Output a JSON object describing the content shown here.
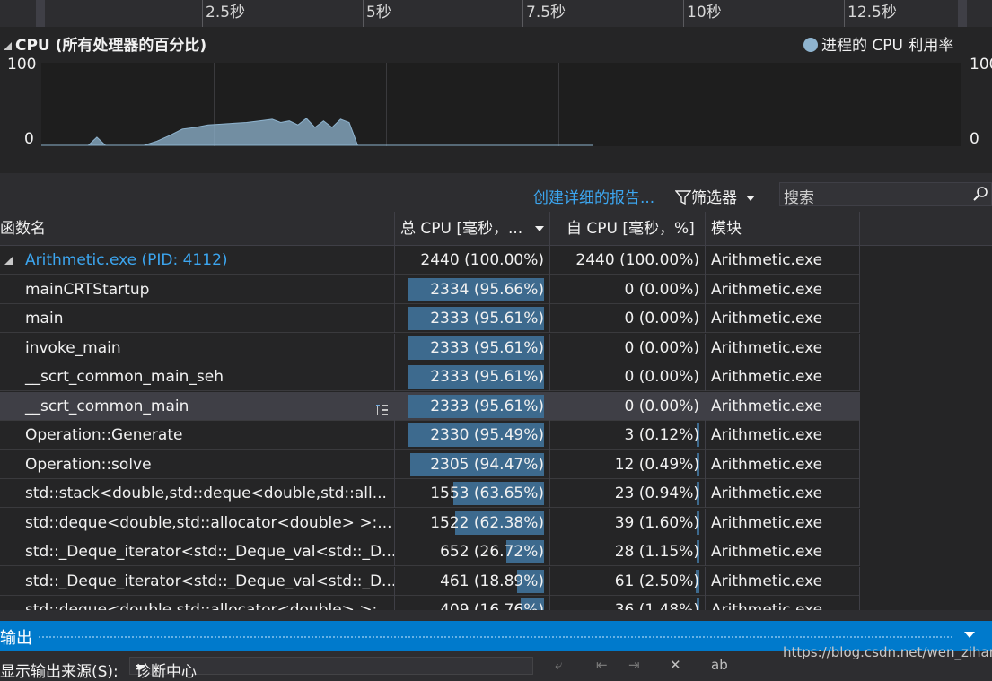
{
  "timeline": {
    "ticks": [
      "2.5秒",
      "5秒",
      "7.5秒",
      "10秒",
      "12.5秒"
    ]
  },
  "cpu_panel": {
    "title": "CPU (所有处理器的百分比)",
    "legend": "进程的 CPU 利用率",
    "y_max_left": "100",
    "y_min_left": "0",
    "y_max_right": "100",
    "y_min_right": "0",
    "series_color": "#8fb4cf"
  },
  "chart_data": {
    "type": "area",
    "title": "CPU (所有处理器的百分比)",
    "ylim": [
      0,
      100
    ],
    "series": [
      {
        "name": "进程的 CPU 利用率",
        "x": [
          0.0,
          1.1,
          1.3,
          1.5,
          2.4,
          2.7,
          3.0,
          3.3,
          3.6,
          3.9,
          4.2,
          4.5,
          4.8,
          5.1,
          5.4,
          5.6,
          5.8,
          6.0,
          6.2,
          6.4,
          6.6,
          6.8,
          7.0,
          7.2,
          7.4,
          7.6,
          12.9
        ],
        "values": [
          0,
          0,
          10,
          0,
          0,
          5,
          12,
          20,
          22,
          25,
          26,
          27,
          28,
          30,
          32,
          28,
          30,
          25,
          33,
          22,
          30,
          22,
          32,
          28,
          0,
          0,
          0
        ]
      }
    ]
  },
  "toolbar": {
    "report_link": "创建详细的报告...",
    "filter_label": "筛选器",
    "search_placeholder": "搜索"
  },
  "table": {
    "columns": [
      "函数名",
      "总 CPU [毫秒，...",
      "自 CPU [毫秒，%]",
      "模块"
    ],
    "rows": [
      {
        "name": "Arithmetic.exe (PID: 4112)",
        "total": "2440 (100.00%)",
        "total_pct": 100.0,
        "self": "2440 (100.00%)",
        "self_pct": 100.0,
        "module": "Arithmetic.exe"
      },
      {
        "name": "mainCRTStartup",
        "total": "2334 (95.66%)",
        "total_pct": 95.66,
        "self": "0 (0.00%)",
        "self_pct": 0.0,
        "module": "Arithmetic.exe"
      },
      {
        "name": "main",
        "total": "2333 (95.61%)",
        "total_pct": 95.61,
        "self": "0 (0.00%)",
        "self_pct": 0.0,
        "module": "Arithmetic.exe"
      },
      {
        "name": "invoke_main",
        "total": "2333 (95.61%)",
        "total_pct": 95.61,
        "self": "0 (0.00%)",
        "self_pct": 0.0,
        "module": "Arithmetic.exe"
      },
      {
        "name": "__scrt_common_main_seh",
        "total": "2333 (95.61%)",
        "total_pct": 95.61,
        "self": "0 (0.00%)",
        "self_pct": 0.0,
        "module": "Arithmetic.exe"
      },
      {
        "name": "__scrt_common_main",
        "total": "2333 (95.61%)",
        "total_pct": 95.61,
        "self": "0 (0.00%)",
        "self_pct": 0.0,
        "module": "Arithmetic.exe"
      },
      {
        "name": "Operation::Generate",
        "total": "2330 (95.49%)",
        "total_pct": 95.49,
        "self": "3 (0.12%)",
        "self_pct": 0.12,
        "module": "Arithmetic.exe"
      },
      {
        "name": "Operation::solve",
        "total": "2305 (94.47%)",
        "total_pct": 94.47,
        "self": "12 (0.49%)",
        "self_pct": 0.49,
        "module": "Arithmetic.exe"
      },
      {
        "name": "std::stack<double,std::deque<double,std::all...",
        "total": "1553 (63.65%)",
        "total_pct": 63.65,
        "self": "23 (0.94%)",
        "self_pct": 0.94,
        "module": "Arithmetic.exe"
      },
      {
        "name": "std::deque<double,std::allocator<double> >:...",
        "total": "1522 (62.38%)",
        "total_pct": 62.38,
        "self": "39 (1.60%)",
        "self_pct": 1.6,
        "module": "Arithmetic.exe"
      },
      {
        "name": "std::_Deque_iterator<std::_Deque_val<std::_D...",
        "total": "652 (26.72%)",
        "total_pct": 26.72,
        "self": "28 (1.15%)",
        "self_pct": 1.15,
        "module": "Arithmetic.exe"
      },
      {
        "name": "std::_Deque_iterator<std::_Deque_val<std::_D...",
        "total": "461 (18.89%)",
        "total_pct": 18.89,
        "self": "61 (2.50%)",
        "self_pct": 2.5,
        "module": "Arithmetic.exe"
      },
      {
        "name": "std::deque<double,std::allocator<double> >:...",
        "total": "409 (16.76%)",
        "total_pct": 16.76,
        "self": "36 (1.48%)",
        "self_pct": 1.48,
        "module": "Arithmetic.exe"
      }
    ]
  },
  "output": {
    "title": "输出",
    "source_label": "显示输出来源(S):",
    "source_value": "诊断中心"
  },
  "watermark": "https://blog.csdn.net/wen_zihan",
  "colors": {
    "accent_blue": "#007acc",
    "link_blue": "#3ca6f0",
    "bar_fill": "#3d6a8e"
  }
}
